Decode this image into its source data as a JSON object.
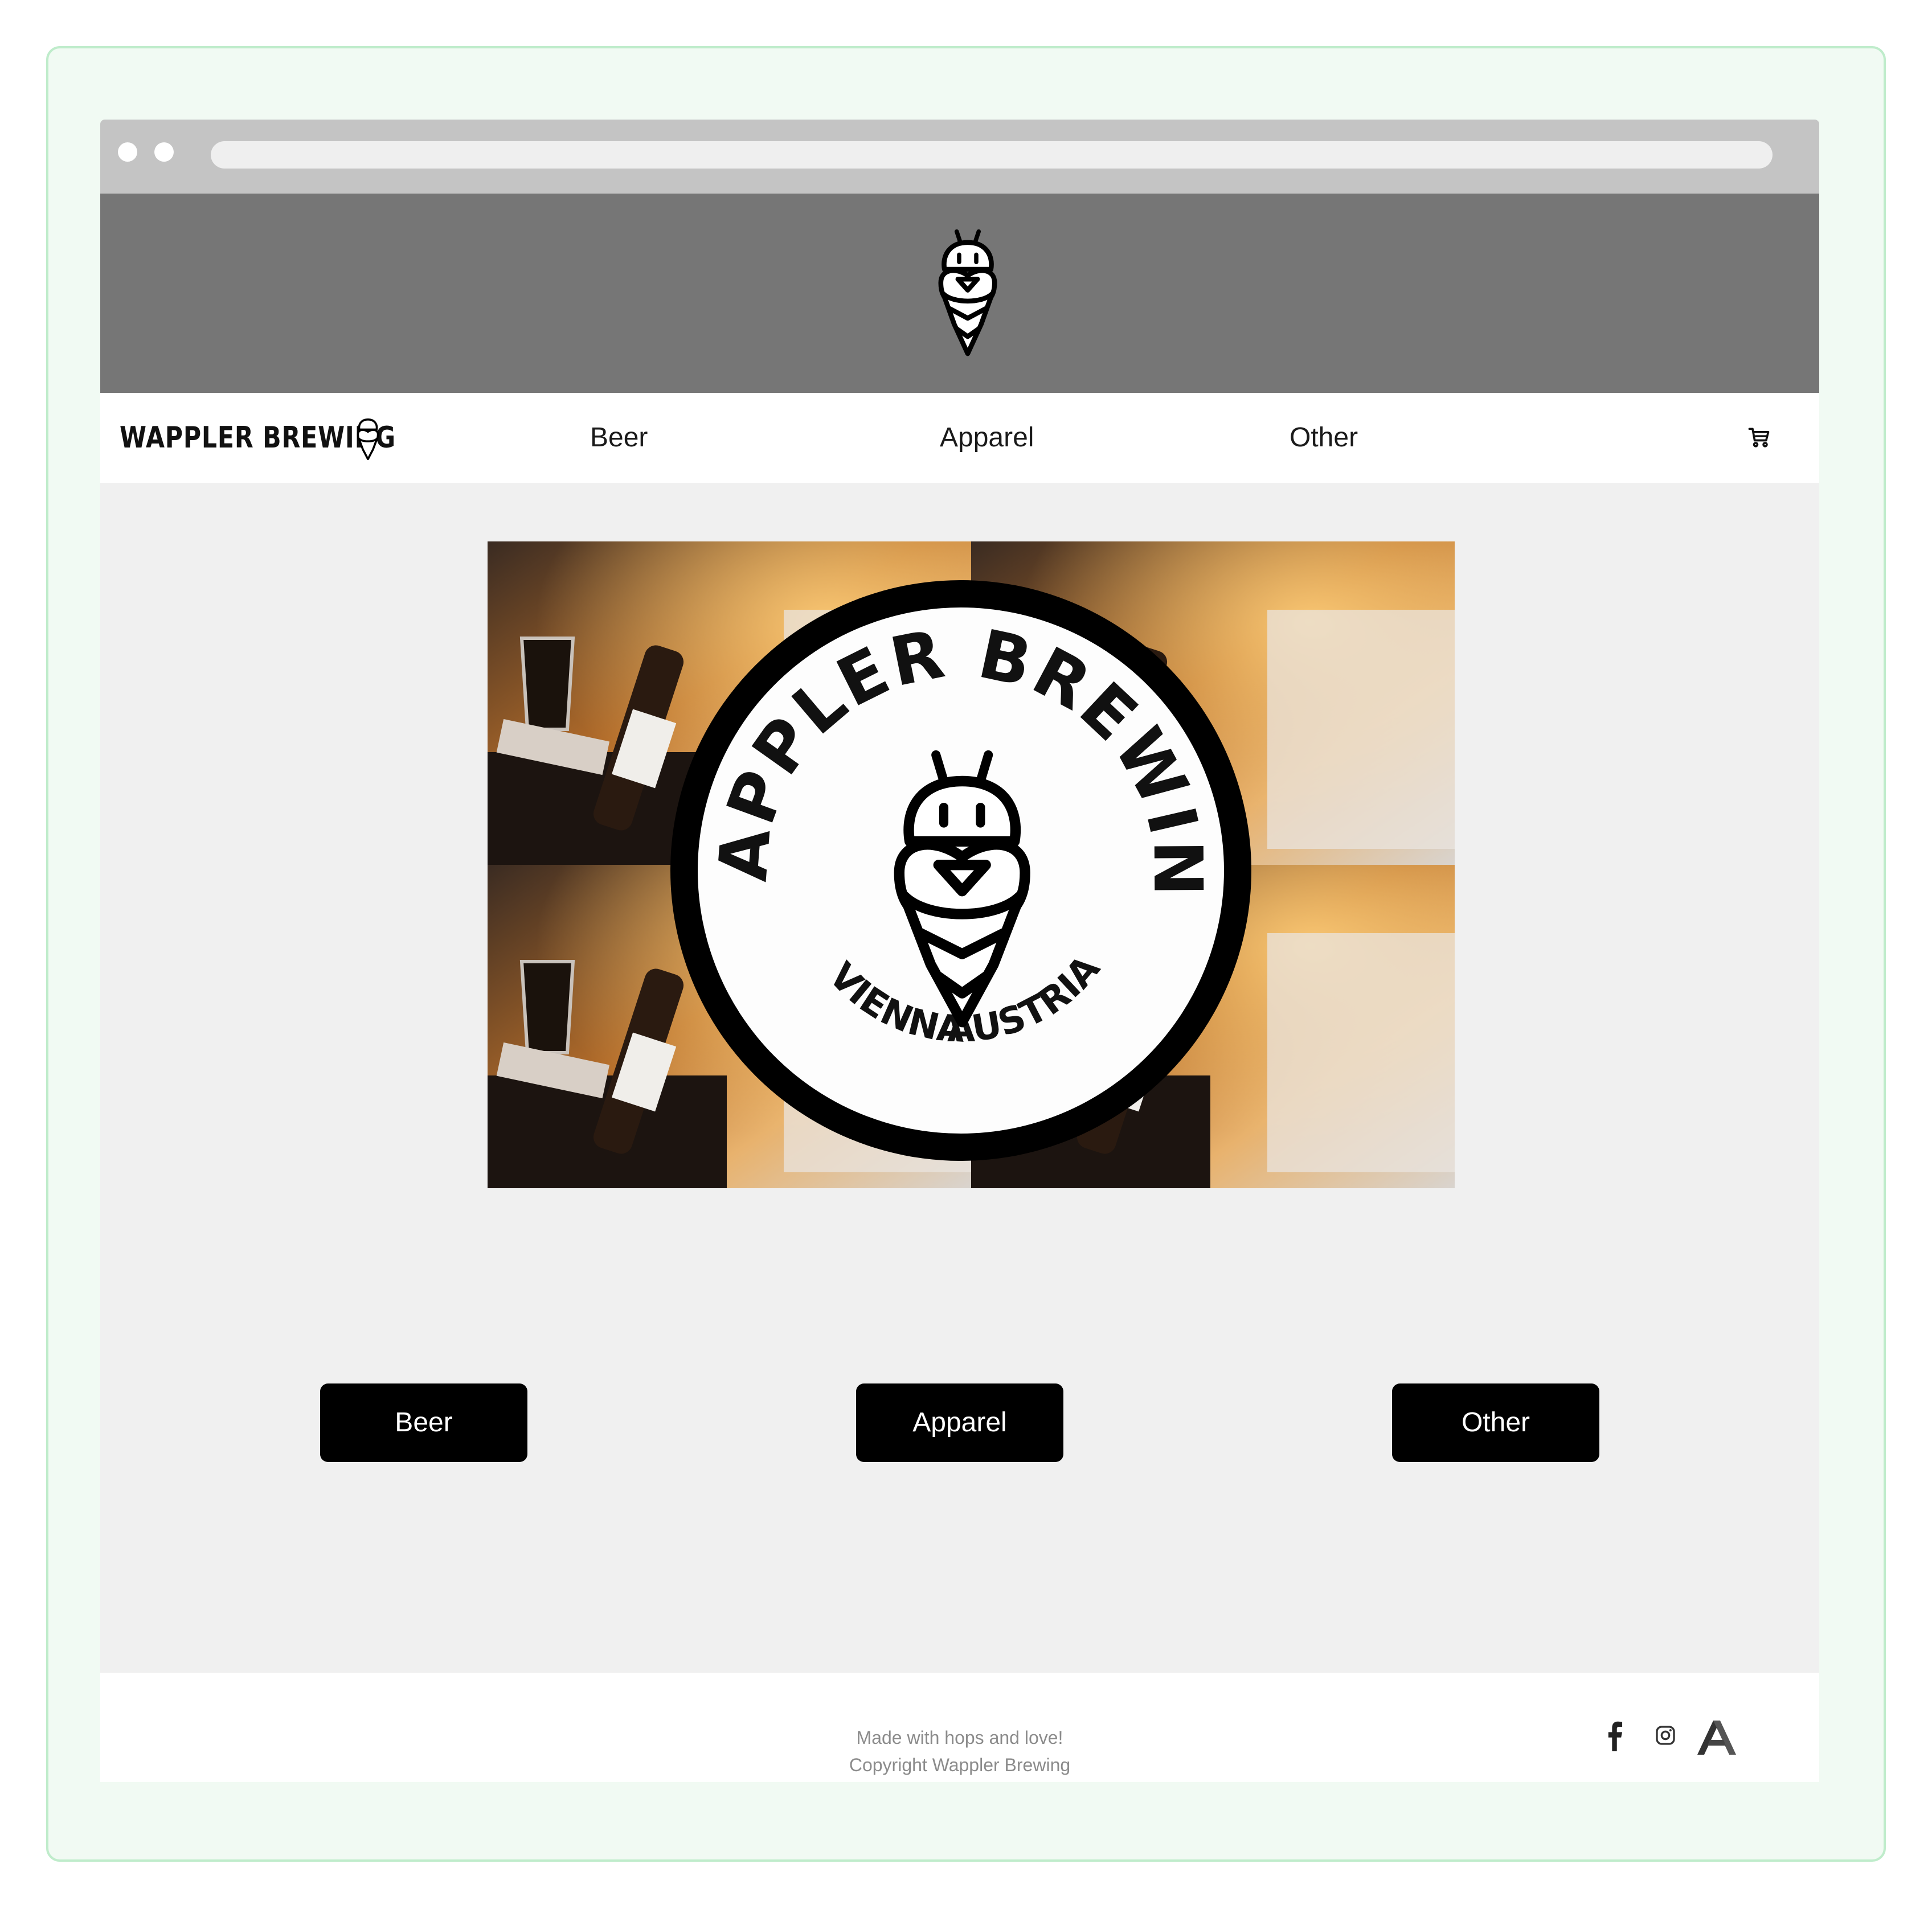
{
  "brand": {
    "name": "WAPPLER BREWING",
    "logo_ring_top": "WAPPLER BREWING",
    "logo_ring_bottom_left": "VIENNA",
    "logo_ring_bottom_right": "AUSTRIA"
  },
  "nav": {
    "links": [
      {
        "label": "Beer"
      },
      {
        "label": "Apparel"
      },
      {
        "label": "Other"
      }
    ],
    "cart_icon": "cart-icon"
  },
  "categories": {
    "buttons": [
      {
        "label": "Beer"
      },
      {
        "label": "Apparel"
      },
      {
        "label": "Other"
      }
    ]
  },
  "footer": {
    "line1": "Made with hops and love!",
    "line2": "Copyright Wappler Brewing",
    "social": [
      "facebook-icon",
      "instagram-icon",
      "wappler-icon"
    ]
  },
  "colors": {
    "frame_border": "#bfeccb",
    "frame_bg": "#f1faf3",
    "banner_bg": "#767676",
    "main_bg": "#f0f0f0",
    "button_bg": "#000000",
    "button_text": "#ffffff"
  }
}
